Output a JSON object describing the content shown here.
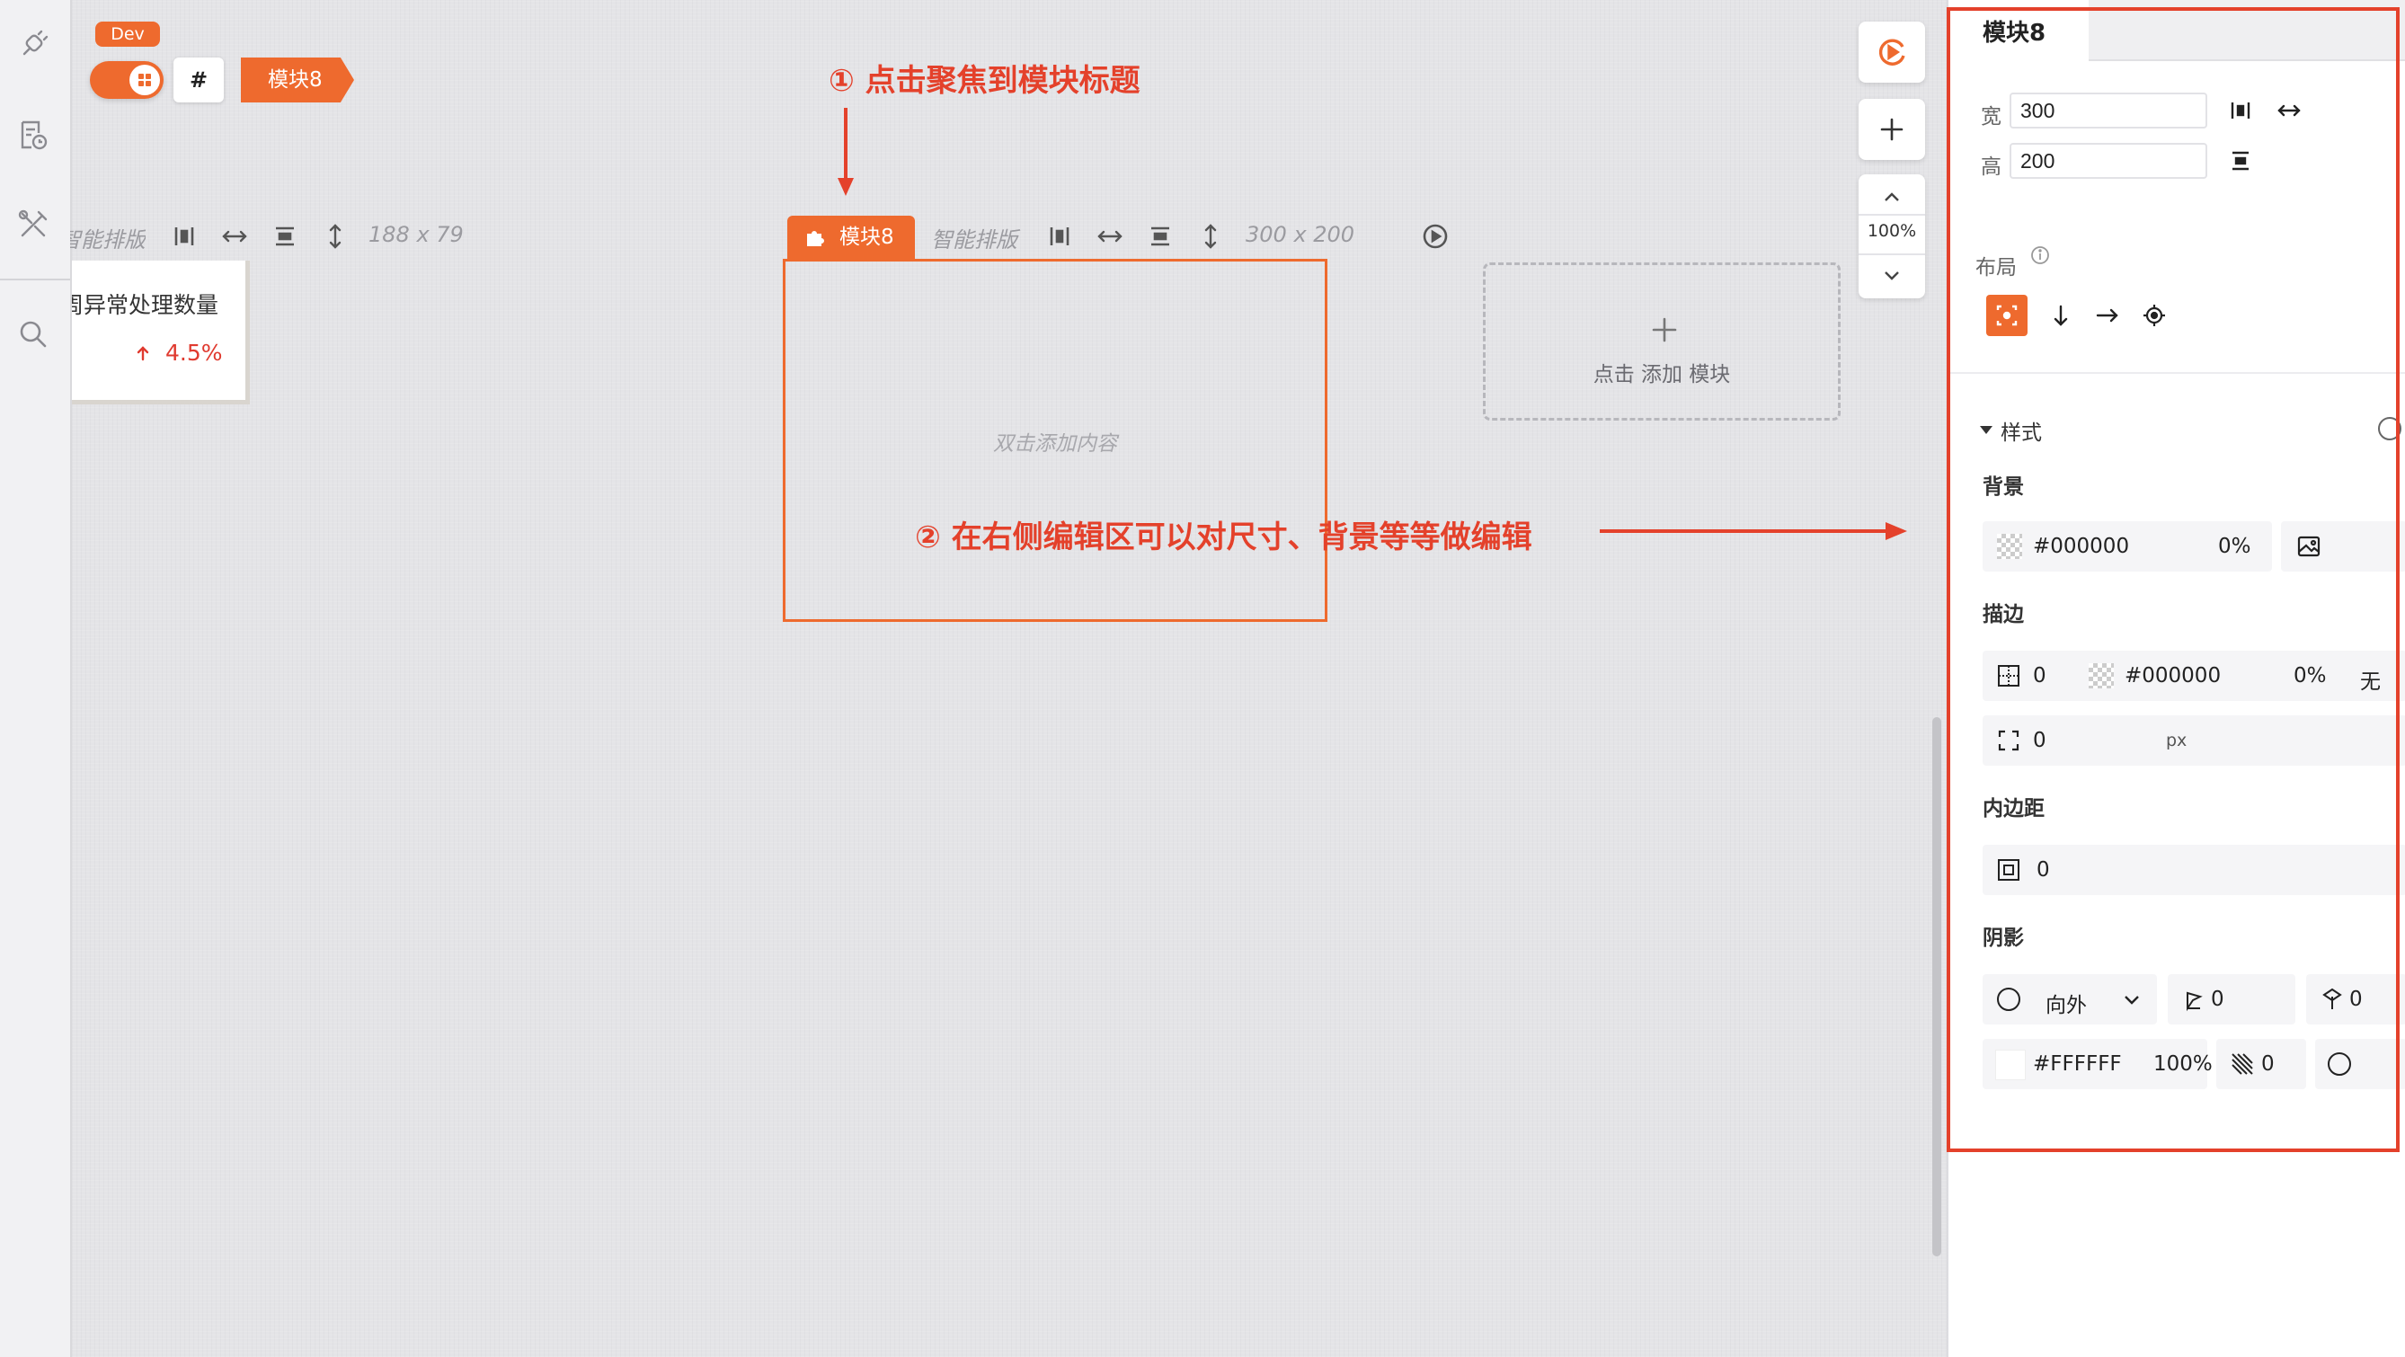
{
  "env_badge": "Dev",
  "breadcrumb": {
    "hash": "#",
    "module": "模块8"
  },
  "left_module": {
    "toolbar": {
      "smart_layout": "智能排版",
      "size": "188 x 79"
    },
    "card": {
      "title": "周异常处理数量",
      "value": "4.5%"
    }
  },
  "active_module": {
    "tab_label": "模块8",
    "toolbar": {
      "smart_layout": "智能排版",
      "size": "300 x 200"
    },
    "placeholder": "双击添加内容"
  },
  "add_module": {
    "label": "点击 添加 模块"
  },
  "annotations": {
    "step1": "① 点击聚焦到模块标题",
    "step2": "② 在右侧编辑区可以对尺寸、背景等等做编辑"
  },
  "zoom": {
    "level": "100%"
  },
  "panel": {
    "tab": "模块8",
    "width_label": "宽",
    "width_value": "300",
    "height_label": "高",
    "height_value": "200",
    "layout_label": "布局",
    "style_section": "样式",
    "background_label": "背景",
    "background_color": "#000000",
    "background_opacity": "0%",
    "stroke_label": "描边",
    "stroke_width": "0",
    "stroke_color": "#000000",
    "stroke_opacity": "0%",
    "stroke_style": "无",
    "radius_value": "0",
    "radius_unit": "px",
    "padding_label": "内边距",
    "padding_value": "0",
    "shadow_label": "阴影",
    "shadow_direction": "向外",
    "shadow_x": "0",
    "shadow_y": "0",
    "shadow_color": "#FFFFFF",
    "shadow_opacity": "100%",
    "shadow_blur": "0"
  },
  "colors": {
    "accent": "#ee6a2e",
    "annotation": "#e4412b"
  }
}
